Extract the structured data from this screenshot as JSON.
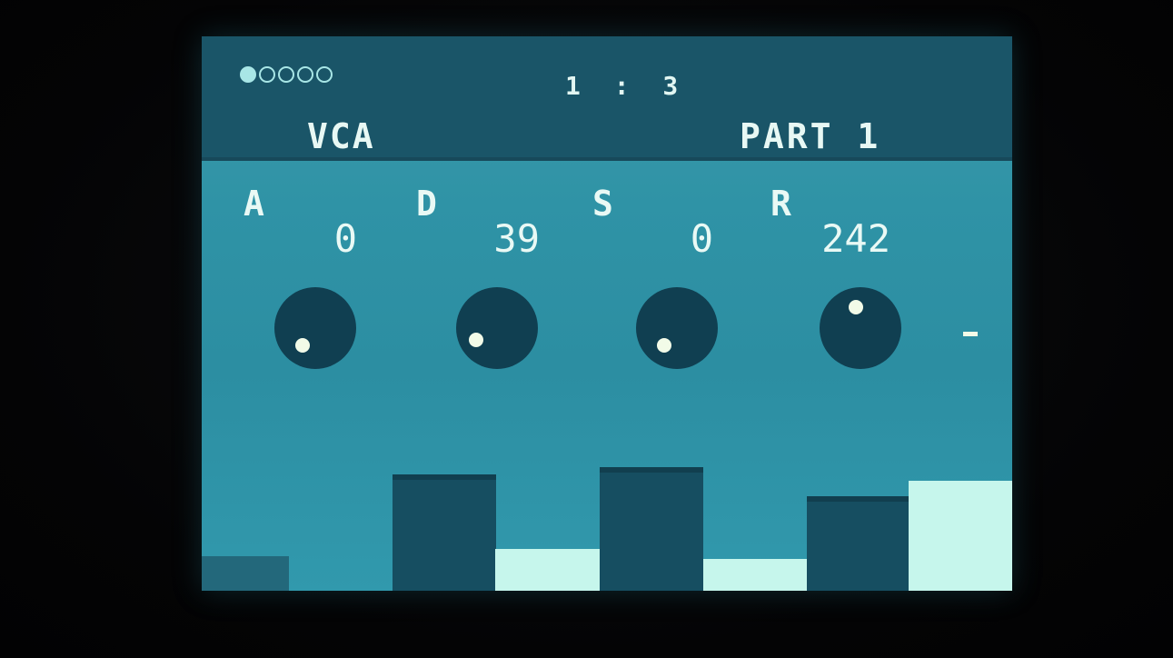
{
  "header": {
    "page_dots": [
      true,
      false,
      false,
      false,
      false
    ],
    "position": "1 : 3",
    "page_name": "VCA",
    "part_name": "PART 1"
  },
  "params": [
    {
      "letter": "A",
      "value": "0"
    },
    {
      "letter": "D",
      "value": "39"
    },
    {
      "letter": "S",
      "value": "0"
    },
    {
      "letter": "R",
      "value": "242"
    }
  ],
  "colors": {
    "screen_bg": "#2f93a6",
    "header_bg": "#1a5568",
    "knob": "#103f51",
    "text": "#e8f8f4",
    "bar_dark": "#164e61",
    "bar_light": "#c6f6ec"
  }
}
